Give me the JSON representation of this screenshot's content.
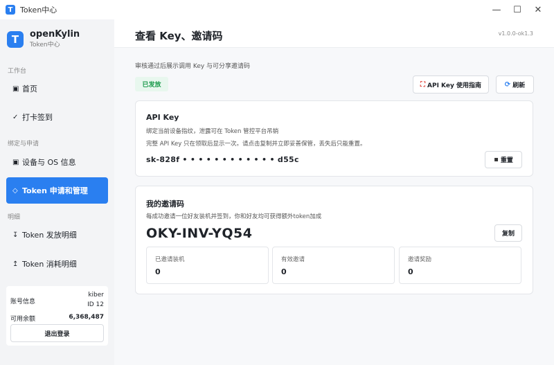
{
  "window": {
    "title": "Token中心",
    "controls": {
      "minimize": "—",
      "maximize": "☐",
      "close": "✕"
    }
  },
  "sidebar": {
    "brand_name": "openKylin",
    "brand_sub": "Token中心",
    "sections": [
      {
        "label": "工作台",
        "items": [
          {
            "icon": "▣",
            "label": "首页"
          },
          {
            "icon": "✓",
            "label": "打卡签到"
          }
        ]
      },
      {
        "label": "绑定与申请",
        "items": [
          {
            "icon": "▣",
            "label": "设备与 OS 信息"
          },
          {
            "icon": "◇",
            "label": "Token 申请和管理"
          }
        ]
      },
      {
        "label": "明细",
        "items": [
          {
            "icon": "↧",
            "label": "Token 发放明细"
          },
          {
            "icon": "↥",
            "label": "Token 消耗明细"
          }
        ]
      }
    ],
    "account": {
      "label": "账号信息",
      "username": "kiber",
      "user_id": "ID 12",
      "balance_label": "可用余额",
      "balance": "6,368,487",
      "logout_label": "退出登录"
    }
  },
  "main": {
    "title": "查看 Key、邀请码",
    "version": "v1.0.0-ok1.3",
    "subtitle": "审核通过后展示调用 Key 与可分享邀请码",
    "status": "已发放",
    "guide_button": "API Key 使用指南",
    "refresh_button": "刷新",
    "api_card": {
      "title": "API Key",
      "desc1": "绑定当前设备指纹，泄露可在 Token 管控平台吊销",
      "desc2": "完整 API Key 只在领取后显示一次。请点击复制并立即妥善保管，丢失后只能重置。",
      "key": "sk-828f • • • • • • • • • • • • d55c",
      "reset_button": "重置"
    },
    "invite_card": {
      "title": "我的邀请码",
      "desc": "每成功邀请一位好友装机并签到，你和好友均可获得额外token加成",
      "code": "OKY-INV-YQ54",
      "copy_button": "复制",
      "stats": [
        {
          "label": "已邀请装机",
          "value": "0"
        },
        {
          "label": "有效邀请",
          "value": "0"
        },
        {
          "label": "邀请奖励",
          "value": "0"
        }
      ]
    }
  },
  "colors": {
    "accent": "#2a7ff0",
    "status_green": "#1a9a4b",
    "status_bg": "#e8f7ee"
  }
}
